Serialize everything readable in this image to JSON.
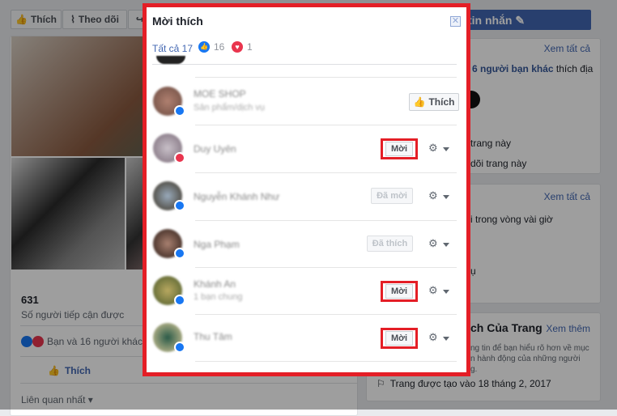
{
  "background": {
    "page_actions": {
      "like": "Thích",
      "follow": "Theo dõi"
    },
    "message_button": "tin nhắn",
    "reach": {
      "count": "631",
      "label": "Số người tiếp cận được"
    },
    "reactions_text": "Bạn và 16 người khác",
    "like_action": "Thích",
    "sort": "Liên quan nhất",
    "community": {
      "see_all": "Xem tất cả",
      "friends_text": "6 người bạn khác",
      "friends_suffix": "thích địa",
      "likes_line": "trang này",
      "follows_line": "dõi trang này"
    },
    "about": {
      "see_all": "Xem tất cả",
      "response": "i trong vòng vài giờ",
      "category": "ụ"
    },
    "transparency": {
      "title": "ch Của Trang",
      "see_more": "Xem thêm",
      "desc1": "ng tin để bạn hiểu rõ hơn về mục",
      "desc2": "n hành động của những người",
      "desc3": "g.",
      "created": "Trang được tạo vào 18 tháng 2, 2017"
    }
  },
  "modal": {
    "title": "Mời thích",
    "tabs": {
      "all": "Tất cả 17",
      "like_count": "16",
      "love_count": "1"
    },
    "rows": [
      {
        "name": "MOE SHOP",
        "sub": "Sản phẩm/dịch vụ",
        "reaction": "like",
        "action": "Thích"
      },
      {
        "name": "Duy Uyên",
        "sub": "",
        "reaction": "love",
        "action": "Mời"
      },
      {
        "name": "Nguyễn Khánh Như",
        "sub": "",
        "reaction": "like",
        "action": "Đã mời"
      },
      {
        "name": "Nga Phạm",
        "sub": "",
        "reaction": "like",
        "action": "Đã thích"
      },
      {
        "name": "Khánh An",
        "sub": "1 bạn chung",
        "reaction": "like",
        "action": "Mời"
      },
      {
        "name": "Thu Tâm",
        "sub": "",
        "reaction": "like",
        "action": "Mời"
      }
    ]
  },
  "colors": {
    "highlight": "#e41e26",
    "link": "#4267b2",
    "like": "#1877f2",
    "love": "#e9354e"
  }
}
